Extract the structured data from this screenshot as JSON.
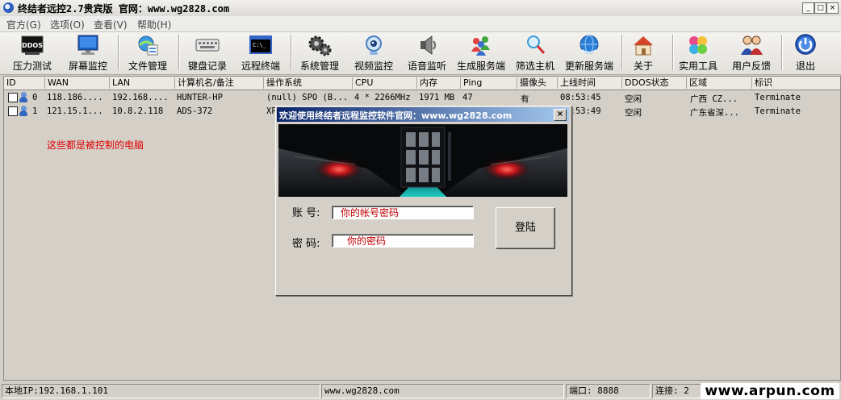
{
  "window": {
    "title": "终结者远控2.7贵宾版 官网：www.wg2828.com",
    "minimize": "_",
    "maximize": "□",
    "close": "×"
  },
  "menu": [
    "官方(G)",
    "选项(O)",
    "查看(V)",
    "帮助(H)"
  ],
  "toolbar": [
    {
      "label": "压力测试",
      "icon": "ddos-icon"
    },
    {
      "label": "屏幕监控",
      "icon": "monitor-icon"
    },
    {
      "label": "文件管理",
      "icon": "file-manager-icon"
    },
    {
      "label": "键盘记录",
      "icon": "keyboard-icon"
    },
    {
      "label": "远程终端",
      "icon": "terminal-icon"
    },
    {
      "label": "系统管理",
      "icon": "gears-icon"
    },
    {
      "label": "视频监控",
      "icon": "webcam-icon"
    },
    {
      "label": "语音监听",
      "icon": "speaker-icon"
    },
    {
      "label": "生成服务端",
      "icon": "users-icon"
    },
    {
      "label": "筛选主机",
      "icon": "filter-search-icon"
    },
    {
      "label": "更新服务端",
      "icon": "globe-icon"
    },
    {
      "label": "关于",
      "icon": "house-icon"
    },
    {
      "label": "实用工具",
      "icon": "apps-icon"
    },
    {
      "label": "用户反馈",
      "icon": "people-icon"
    },
    {
      "label": "退出",
      "icon": "power-icon"
    }
  ],
  "table": {
    "columns": [
      "ID",
      "WAN",
      "LAN",
      "计算机名/备注",
      "操作系统",
      "CPU",
      "内存",
      "Ping",
      "摄像头",
      "上线时间",
      "DDOS状态",
      "区域",
      "标识"
    ],
    "rows": [
      [
        "0",
        "118.186....",
        "192.168....",
        "HUNTER-HP",
        "(null) SPO (B...",
        "4 * 2266MHz",
        "1971 MB",
        "47",
        "有",
        "08:53:45",
        "空闲",
        "广西  CZ...",
        "Terminate"
      ],
      [
        "1",
        "121.15.1...",
        "10.8.2.118",
        "ADS-372",
        "XP",
        "",
        "",
        "",
        "",
        "08:53:49",
        "空闲",
        "广东省深...",
        "Terminate"
      ]
    ]
  },
  "annotation": "这些都是被控制的电脑",
  "status": {
    "local_ip": "本地IP:192.168.1.101",
    "site": "www.wg2828.com",
    "port": "端口: 8888",
    "connections": "连接: 2",
    "watermark": "www.arpun.com"
  },
  "dialog": {
    "title": "欢迎使用终结者远程监控软件官网：www.wg2828.com",
    "close": "×",
    "account_label": "账 号:",
    "account_value": "你的帐号密码",
    "password_label": "密 码:",
    "password_value": "你的密码",
    "login_button": "登陆"
  }
}
